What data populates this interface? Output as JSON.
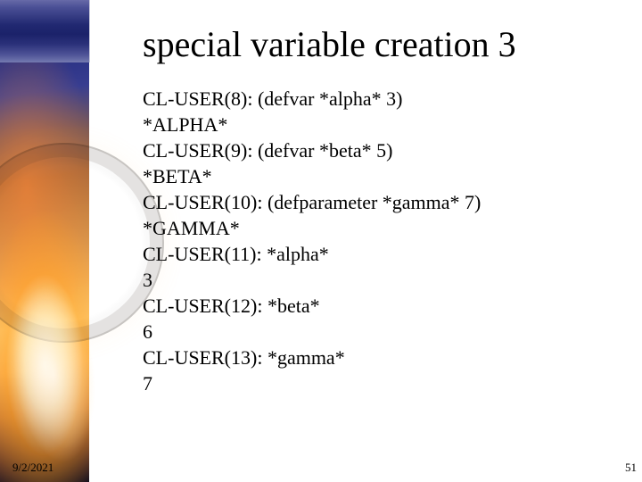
{
  "title": "special variable creation 3",
  "repl_lines": [
    "CL-USER(8): (defvar *alpha* 3)",
    "*ALPHA*",
    "CL-USER(9): (defvar *beta* 5)",
    "*BETA*",
    "CL-USER(10): (defparameter *gamma* 7)",
    "*GAMMA*",
    "CL-USER(11): *alpha*",
    "3",
    "CL-USER(12): *beta*",
    "6",
    "CL-USER(13): *gamma*",
    "7"
  ],
  "footer": {
    "date": "9/2/2021",
    "page": "51"
  }
}
